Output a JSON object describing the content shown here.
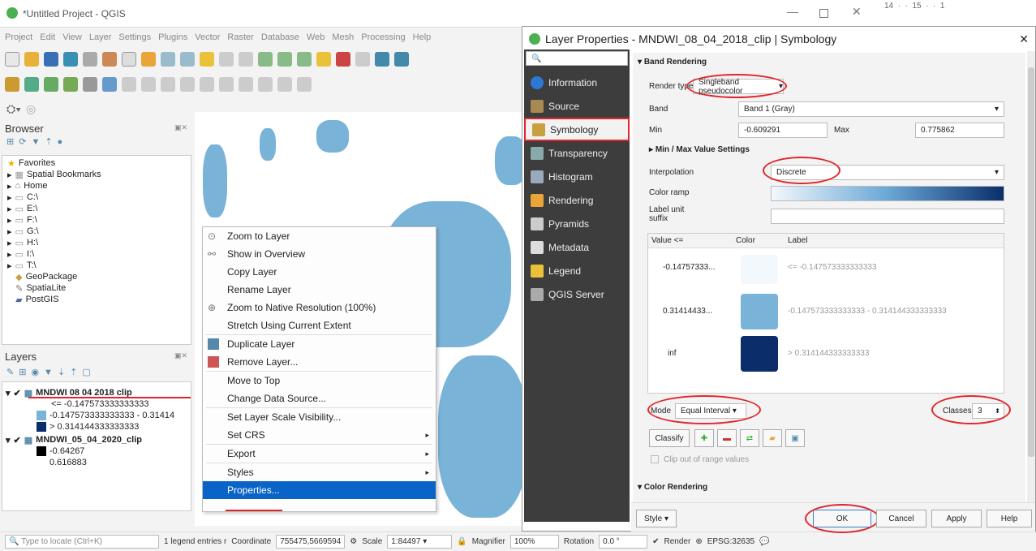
{
  "app": {
    "title": "*Untitled Project - QGIS",
    "ruler": "14  ·  ·  15  ·  ·  1"
  },
  "menu": [
    "Project",
    "Edit",
    "View",
    "Layer",
    "Settings",
    "Plugins",
    "Vector",
    "Raster",
    "Database",
    "Web",
    "Mesh",
    "Processing",
    "Help"
  ],
  "browser": {
    "title": "Browser",
    "items": [
      "Favorites",
      "Spatial Bookmarks",
      "Home",
      "C:\\",
      "E:\\",
      "F:\\",
      "G:\\",
      "H:\\",
      "I:\\",
      "T:\\",
      "GeoPackage",
      "SpatiaLite",
      "PostGIS"
    ]
  },
  "layers": {
    "title": "Layers",
    "layer1": {
      "name": "MNDWI 08 04 2018 clip",
      "legend": [
        "<= -0.147573333333333",
        "-0.147573333333333 - 0.31414",
        "> 0.314144333333333"
      ],
      "colors": [
        "#f2f8fc",
        "#7ab3d8",
        "#0b2e6b"
      ]
    },
    "layer2": {
      "name": "MNDWI_05_04_2020_clip",
      "min": "-0.64267",
      "max": "0.616883"
    }
  },
  "context_menu": [
    "Zoom to Layer",
    "Show in Overview",
    "Copy Layer",
    "Rename Layer",
    "Zoom to Native Resolution (100%)",
    "Stretch Using Current Extent",
    "Duplicate Layer",
    "Remove Layer...",
    "Move to Top",
    "Change Data Source...",
    "Set Layer Scale Visibility...",
    "Set CRS",
    "Export",
    "Styles",
    "Properties..."
  ],
  "dialog": {
    "title": "Layer Properties - MNDWI_08_04_2018_clip | Symbology",
    "nav": [
      "Information",
      "Source",
      "Symbology",
      "Transparency",
      "Histogram",
      "Rendering",
      "Pyramids",
      "Metadata",
      "Legend",
      "QGIS Server"
    ],
    "band_rendering": "Band Rendering",
    "render_type_label": "Render type",
    "render_type": "Singleband pseudocolor",
    "band_label": "Band",
    "band": "Band 1 (Gray)",
    "min_label": "Min",
    "min": "-0.609291",
    "max_label": "Max",
    "max": "0.775862",
    "minmax": "Min / Max Value Settings",
    "interp_label": "Interpolation",
    "interp": "Discrete",
    "ramp_label": "Color ramp",
    "unit_label": "Label unit suffix",
    "cols": [
      "Value <=",
      "Color",
      "Label"
    ],
    "classes": [
      {
        "value": "-0.14757333...",
        "color": "#f2f8fc",
        "label": "<= -0.147573333333333"
      },
      {
        "value": "0.31414433...",
        "color": "#7ab3d8",
        "label": "-0.147573333333333 - 0.314144333333333"
      },
      {
        "value": "inf",
        "color": "#0b2e6b",
        "label": "> 0.314144333333333"
      }
    ],
    "mode_label": "Mode",
    "mode": "Equal Interval",
    "classes_label": "Classes",
    "classes_n": "3",
    "classify": "Classify",
    "clip": "Clip out of range values",
    "color_rendering": "Color Rendering",
    "style": "Style",
    "ok": "OK",
    "cancel": "Cancel",
    "apply": "Apply",
    "help": "Help"
  },
  "status": {
    "locate": "Type to locate (Ctrl+K)",
    "legend": "1 legend entries r",
    "coord_label": "Coordinate",
    "coord": "755475,5669594",
    "scale_label": "Scale",
    "scale": "1:84497",
    "mag_label": "Magnifier",
    "mag": "100%",
    "rot_label": "Rotation",
    "rot": "0.0 °",
    "render": "Render",
    "crs": "EPSG:32635"
  }
}
